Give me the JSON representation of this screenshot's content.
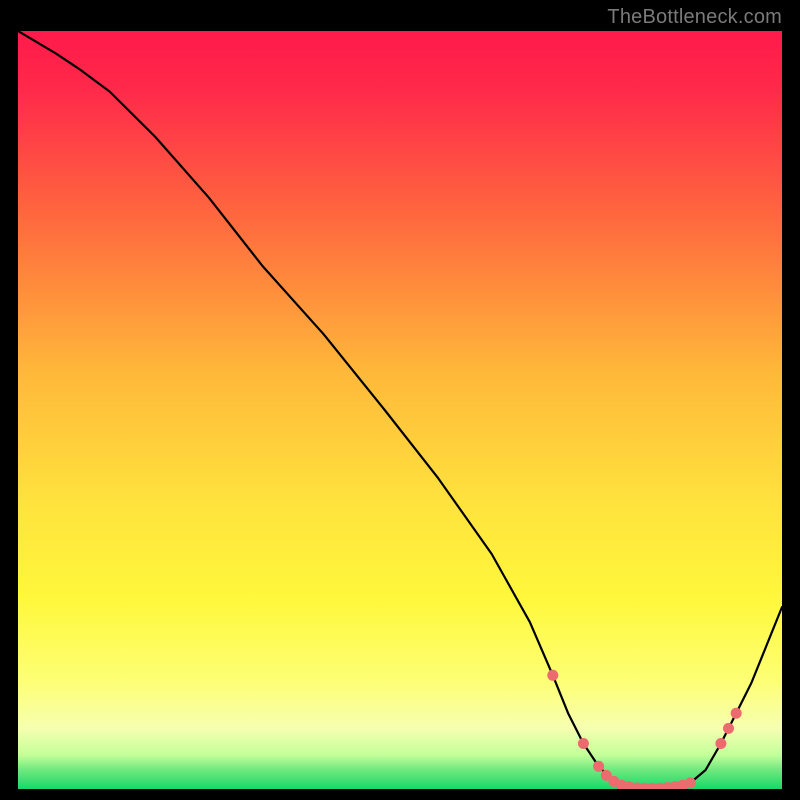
{
  "watermark": "TheBottleneck.com",
  "colors": {
    "bg": "#000000",
    "curve": "#000000",
    "marker_fill": "#ed6a6f",
    "marker_stroke": "#ed6a6f",
    "grad_top": "#ff1a4b",
    "grad_mid1": "#ff8a3d",
    "grad_mid2": "#ffe23d",
    "grad_yellow": "#fff83c",
    "grad_pale": "#f6ffb0",
    "grad_green": "#19d86a"
  },
  "chart_data": {
    "type": "line",
    "title": "",
    "xlabel": "",
    "ylabel": "",
    "xlim": [
      0,
      100
    ],
    "ylim": [
      0,
      100
    ],
    "series": [
      {
        "name": "bottleneck-curve",
        "x": [
          0,
          5,
          8,
          12,
          18,
          25,
          32,
          40,
          48,
          55,
          62,
          67,
          70,
          72,
          74,
          76,
          78,
          80,
          82,
          84,
          86,
          88,
          90,
          92,
          94,
          96,
          98,
          100
        ],
        "y": [
          100,
          97,
          95,
          92,
          86,
          78,
          69,
          60,
          50,
          41,
          31,
          22,
          15,
          10,
          6,
          3,
          1,
          0.3,
          0.1,
          0.1,
          0.3,
          0.8,
          2.5,
          6,
          10,
          14,
          19,
          24
        ]
      }
    ],
    "markers": {
      "name": "highlighted-points",
      "x": [
        70,
        74,
        76,
        77,
        78,
        79,
        80,
        81,
        82,
        83,
        84,
        85,
        86,
        87,
        88,
        92,
        93,
        94
      ],
      "y": [
        15,
        6,
        3,
        1.8,
        1.0,
        0.5,
        0.3,
        0.15,
        0.1,
        0.1,
        0.1,
        0.2,
        0.3,
        0.5,
        0.8,
        6,
        8,
        10
      ]
    }
  }
}
